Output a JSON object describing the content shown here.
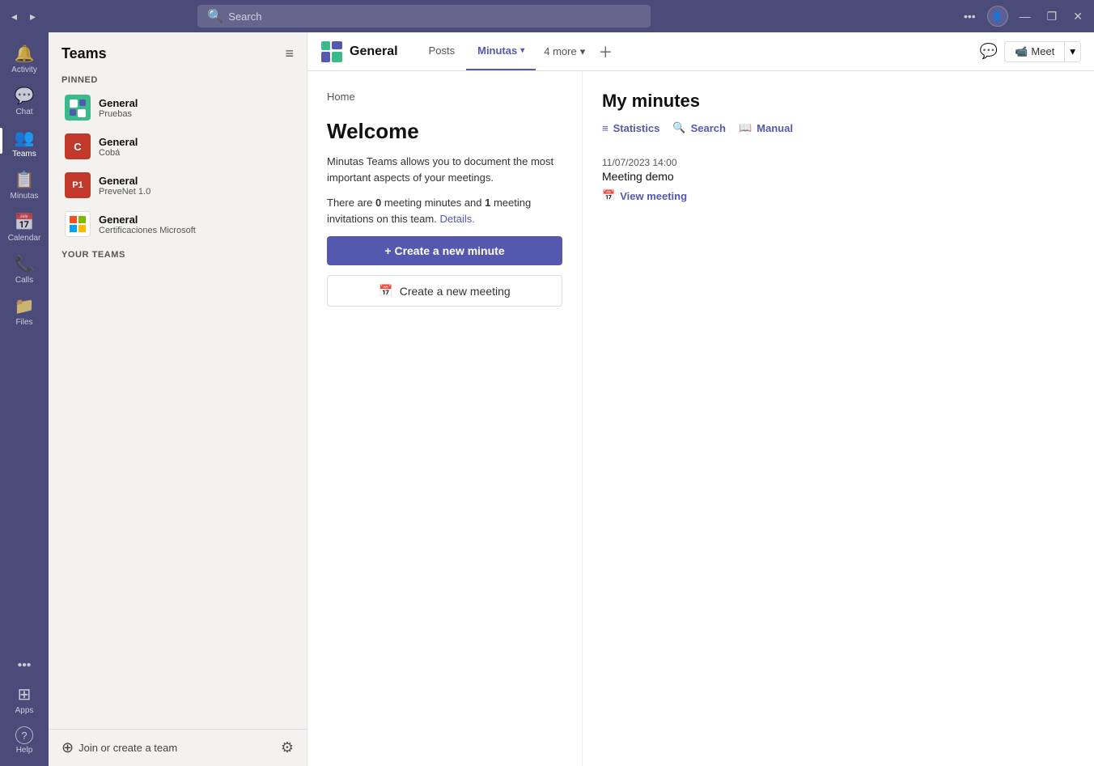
{
  "titlebar": {
    "search_placeholder": "Search",
    "back_label": "◂",
    "forward_label": "▸",
    "more_label": "•••",
    "minimize_label": "—",
    "maximize_label": "❐",
    "close_label": "✕"
  },
  "sidebar": {
    "title": "Teams",
    "filter_icon": "≡",
    "pinned_label": "Pinned",
    "your_teams_label": "Your teams",
    "teams": [
      {
        "id": "pruebas",
        "name": "General",
        "sub": "Pruebas",
        "color": "#3dba8c",
        "icon": "G",
        "use_image": true
      },
      {
        "id": "coba",
        "name": "General",
        "sub": "Cobá",
        "color": "#c0392b",
        "letter": "C"
      },
      {
        "id": "prevenet",
        "name": "General",
        "sub": "PreveNet 1.0",
        "color": "#e74c3c",
        "letter": "P1"
      },
      {
        "id": "microsoft",
        "name": "General",
        "sub": "Certificaciones Microsoft",
        "color": "#f39c12",
        "use_windows": true
      }
    ],
    "join_label": "Join or create a team",
    "join_icon": "⊕",
    "settings_icon": "⚙"
  },
  "rail": {
    "items": [
      {
        "id": "activity",
        "icon": "🔔",
        "label": "Activity"
      },
      {
        "id": "chat",
        "icon": "💬",
        "label": "Chat"
      },
      {
        "id": "teams",
        "icon": "👥",
        "label": "Teams",
        "active": true
      },
      {
        "id": "minutas",
        "icon": "📋",
        "label": "Minutas"
      },
      {
        "id": "calendar",
        "icon": "📅",
        "label": "Calendar"
      },
      {
        "id": "calls",
        "icon": "📞",
        "label": "Calls"
      },
      {
        "id": "files",
        "icon": "📁",
        "label": "Files"
      }
    ],
    "bottom_items": [
      {
        "id": "more",
        "icon": "•••",
        "label": ""
      },
      {
        "id": "apps",
        "icon": "⊞",
        "label": "Apps"
      },
      {
        "id": "help",
        "icon": "?",
        "label": "Help"
      }
    ]
  },
  "channel": {
    "name": "General",
    "tab_posts": "Posts",
    "tab_minutas": "Minutas",
    "tab_more": "4 more",
    "meet_label": "Meet",
    "chat_icon": "💬"
  },
  "welcome": {
    "breadcrumb": "Home",
    "title": "Welcome",
    "description": "Minutas Teams allows you to document the most important aspects of your meetings.",
    "stats_text_pre": "There are ",
    "stats_count_meetings": "0",
    "stats_text_mid": " meeting minutes and ",
    "stats_count_invitations": "1",
    "stats_text_post": " meeting invitations on this team.",
    "details_link": "Details.",
    "create_minute_label": "+ Create a new minute",
    "create_meeting_label": "Create a new meeting"
  },
  "my_minutes": {
    "title": "My minutes",
    "actions": [
      {
        "id": "statistics",
        "icon": "≡",
        "label": "Statistics"
      },
      {
        "id": "search",
        "icon": "🔍",
        "label": "Search"
      },
      {
        "id": "manual",
        "icon": "📖",
        "label": "Manual"
      }
    ],
    "meeting": {
      "date": "11/07/2023 14:00",
      "name": "Meeting demo",
      "view_label": "View meeting",
      "view_icon": "📅"
    }
  }
}
